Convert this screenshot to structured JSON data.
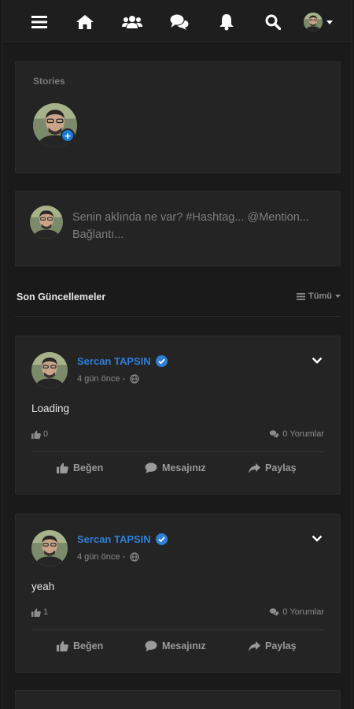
{
  "nav": {
    "items": [
      {
        "name": "menu-icon"
      },
      {
        "name": "home-icon"
      },
      {
        "name": "friends-icon"
      },
      {
        "name": "messages-icon"
      },
      {
        "name": "notifications-icon"
      },
      {
        "name": "search-icon"
      }
    ],
    "profile_icon": "caret-down-icon"
  },
  "stories": {
    "title": "Stories",
    "add_icon": "+"
  },
  "composer": {
    "placeholder": "Senin aklında ne var? #Hashtag... @Mention... Bağlantı..."
  },
  "feed": {
    "title": "Son Güncellemeler",
    "filter_label": "Tümü"
  },
  "posts": [
    {
      "author": "Sercan TAPSIN",
      "time": "4 gün önce -",
      "body": "Loading",
      "likes": "0",
      "comments": "0 Yorumlar",
      "actions": {
        "like": "Beğen",
        "comment": "Mesajınız",
        "share": "Paylaş"
      }
    },
    {
      "author": "Sercan TAPSIN",
      "time": "4 gün önce -",
      "body": "yeah",
      "likes": "1",
      "comments": "0 Yorumlar",
      "actions": {
        "like": "Beğen",
        "comment": "Mesajınız",
        "share": "Paylaş"
      }
    }
  ],
  "colors": {
    "background": "#1a1a1a",
    "card": "#242424",
    "accent": "#2f7ed8",
    "story_badge": "#1d7bd8"
  }
}
